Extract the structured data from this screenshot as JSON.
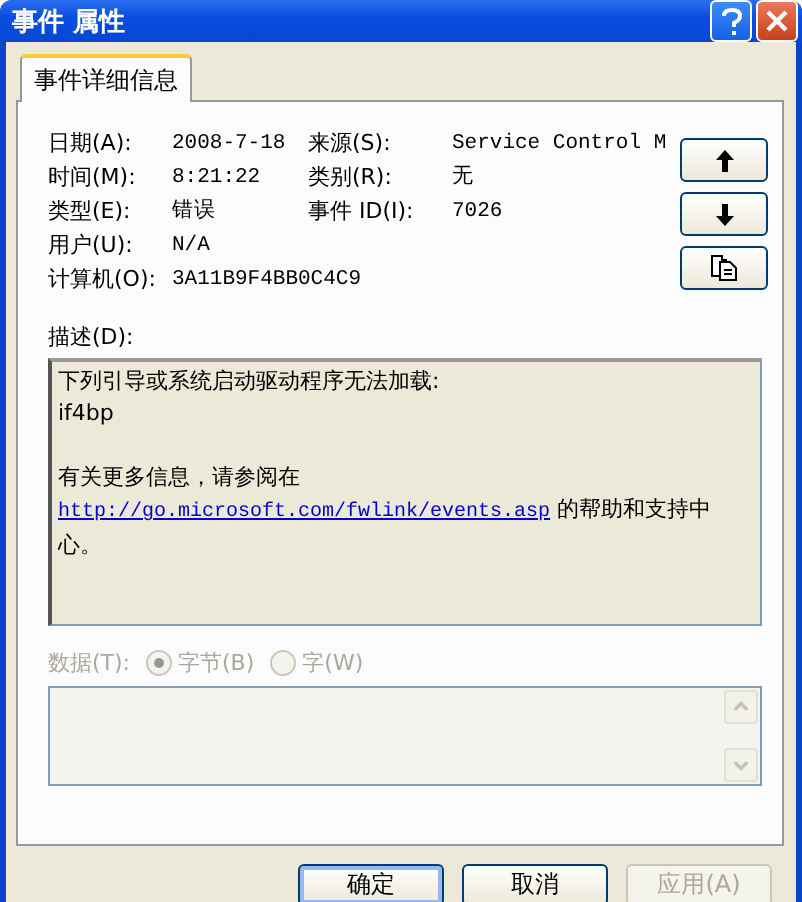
{
  "window": {
    "title": "事件 属性"
  },
  "tabs": [
    {
      "label": "事件详细信息",
      "selected": true
    }
  ],
  "fields": [
    [
      {
        "label": "日期(A):",
        "value": "2008-7-18"
      },
      {
        "label": "来源(S):",
        "value": "Service Control M"
      }
    ],
    [
      {
        "label": "时间(M):",
        "value": "8:21:22"
      },
      {
        "label": "类别(R):",
        "value": "无"
      }
    ],
    [
      {
        "label": "类型(E):",
        "value": "错误"
      },
      {
        "label": "事件 ID(I):",
        "value": "7026"
      }
    ],
    [
      {
        "label": "用户(U):",
        "value": "N/A"
      }
    ],
    [
      {
        "label": "计算机(O):",
        "value": "3A11B9F4BB0C4C9"
      }
    ]
  ],
  "side_buttons": [
    {
      "kind": "up"
    },
    {
      "kind": "down"
    },
    {
      "kind": "copy"
    }
  ],
  "description": {
    "label": "描述(D):",
    "paragraphs": [
      {
        "kind": "plain",
        "lines": [
          "下列引导或系统启动驱动程序无法加载:",
          "if4bp"
        ]
      },
      {
        "kind": "link",
        "lines": [
          "有关更多信息，请参阅在"
        ],
        "link": "http://go.microsoft.com/fwlink/events.asp",
        "after": [
          "的帮助和支持中",
          "心。"
        ]
      }
    ]
  },
  "data": {
    "label": "数据(T):",
    "disabled": true,
    "options": [
      {
        "label": "字节(B)",
        "selected": true
      },
      {
        "label": "字(W)",
        "selected": false
      }
    ]
  },
  "buttons": [
    {
      "label": "确定",
      "default": true,
      "disabled": false
    },
    {
      "label": "取消",
      "default": false,
      "disabled": false
    },
    {
      "label": "应用(A)",
      "default": false,
      "disabled": true
    }
  ]
}
